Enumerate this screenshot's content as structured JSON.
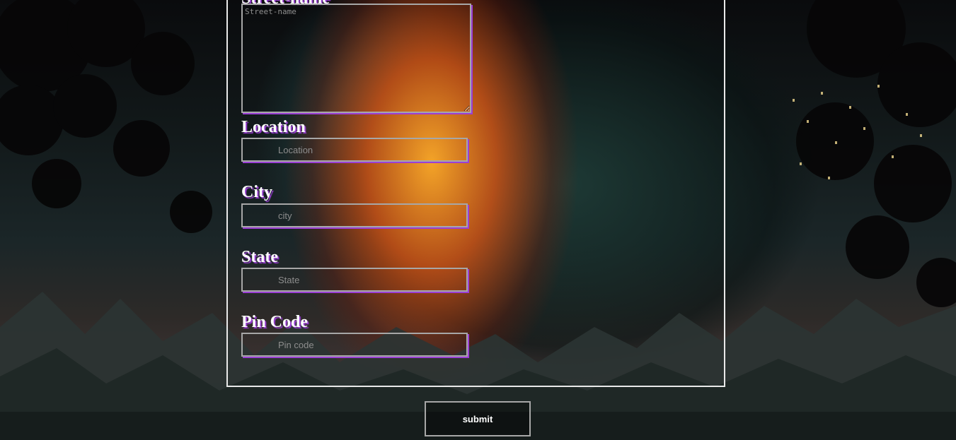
{
  "form": {
    "street_label": "Street-name",
    "street_placeholder": "Street-name",
    "location_label": "Location",
    "location_placeholder": "Location",
    "city_label": "City",
    "city_placeholder": "city",
    "state_label": "State",
    "state_placeholder": "State",
    "pincode_label": "Pin Code",
    "pincode_placeholder": "Pin code",
    "submit_label": "submit"
  },
  "colors": {
    "label_text": "#ffffff",
    "label_shadow": "#9b3fd6",
    "panel_border": "#e9e9e9",
    "input_border": "#a7a7a7"
  }
}
